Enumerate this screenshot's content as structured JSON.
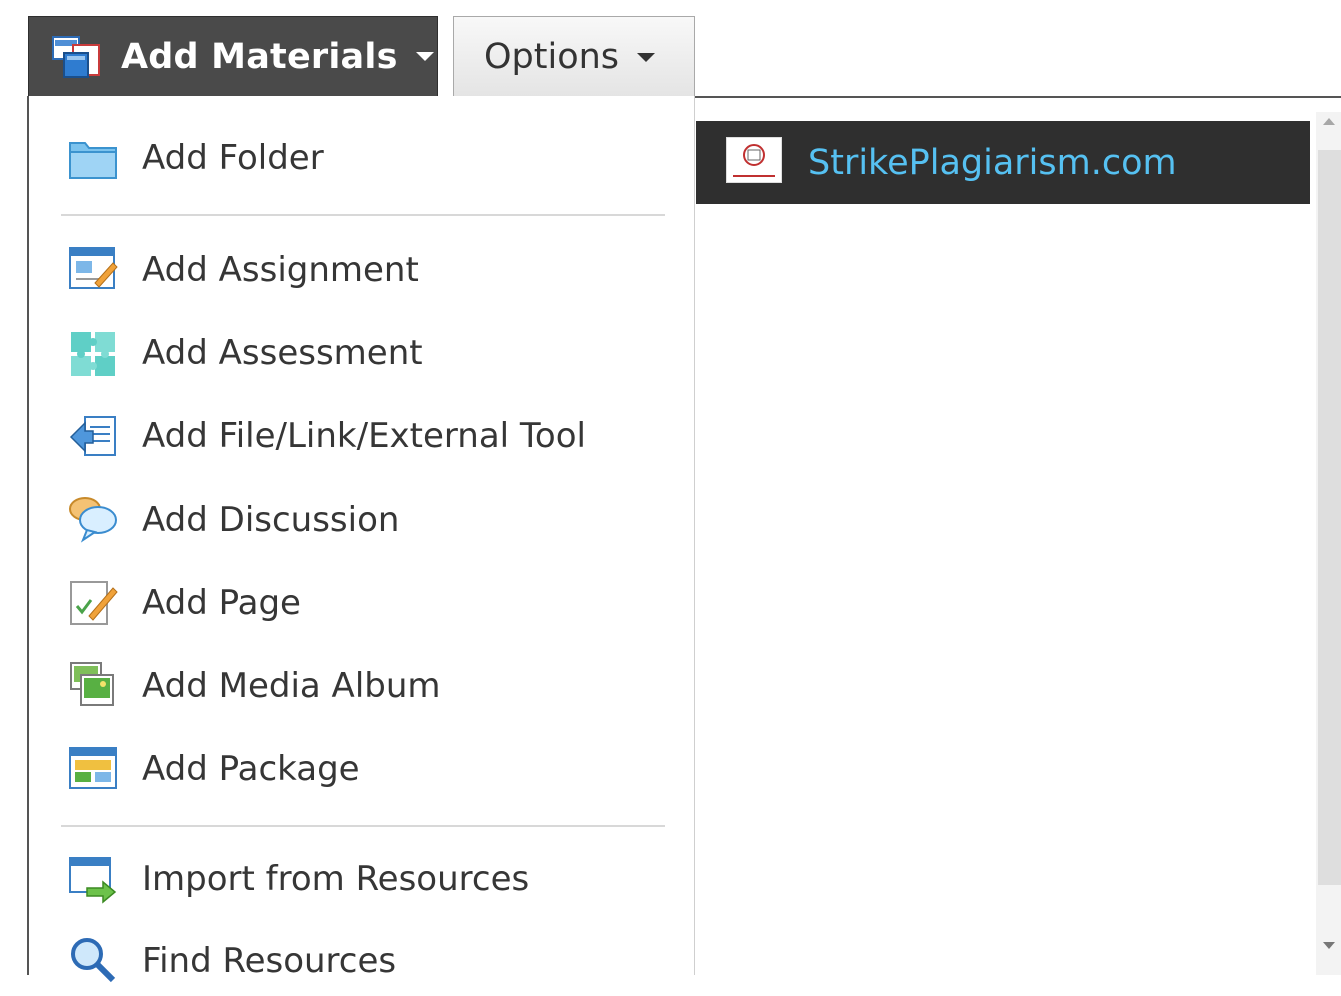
{
  "toolbar": {
    "add_materials_label": "Add Materials",
    "options_label": "Options"
  },
  "menu": {
    "items": [
      {
        "label": "Add Folder",
        "icon": "folder-icon"
      },
      {
        "label": "Add Assignment",
        "icon": "assignment-icon"
      },
      {
        "label": "Add Assessment",
        "icon": "assessment-puzzle-icon"
      },
      {
        "label": "Add File/Link/External Tool",
        "icon": "file-link-icon"
      },
      {
        "label": "Add Discussion",
        "icon": "discussion-icon"
      },
      {
        "label": "Add Page",
        "icon": "page-icon"
      },
      {
        "label": "Add Media Album",
        "icon": "media-album-icon"
      },
      {
        "label": "Add Package",
        "icon": "package-icon"
      },
      {
        "label": "Import from Resources",
        "icon": "import-icon"
      },
      {
        "label": "Find Resources",
        "icon": "search-icon"
      }
    ]
  },
  "content": {
    "link_text": "StrikePlagiarism.com"
  },
  "colors": {
    "button_dark": "#4a4a4a",
    "row_dark": "#2f2f2f",
    "link": "#56c1f2",
    "menu_text": "#363636"
  }
}
